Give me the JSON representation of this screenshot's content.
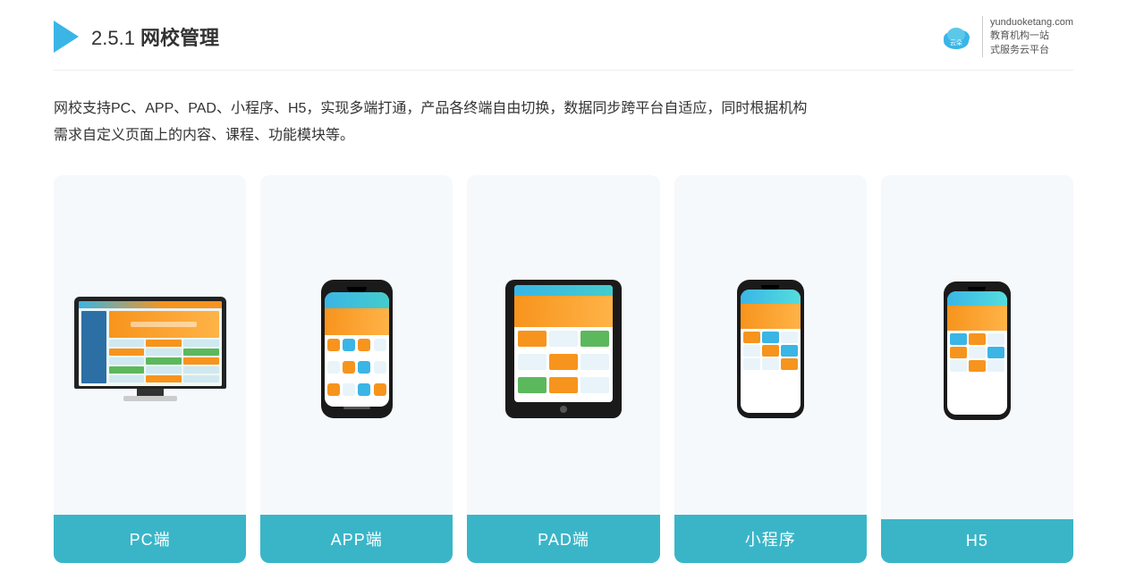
{
  "header": {
    "title_prefix": "2.5.1 ",
    "title_main": "网校管理",
    "brand_name_line1": "教育机构一站",
    "brand_name_line2": "式服务云平台",
    "brand_url": "yunduoketang.com"
  },
  "description": {
    "line1": "网校支持PC、APP、PAD、小程序、H5，实现多端打通，产品各终端自由切换，数据同步跨平台自适应，同时根据机构",
    "line2": "需求自定义页面上的内容、课程、功能模块等。"
  },
  "cards": [
    {
      "id": "pc",
      "label": "PC端",
      "type": "pc"
    },
    {
      "id": "app",
      "label": "APP端",
      "type": "phone"
    },
    {
      "id": "pad",
      "label": "PAD端",
      "type": "pad"
    },
    {
      "id": "miniprogram",
      "label": "小程序",
      "type": "miniphone"
    },
    {
      "id": "h5",
      "label": "H5",
      "type": "miniphone"
    }
  ]
}
